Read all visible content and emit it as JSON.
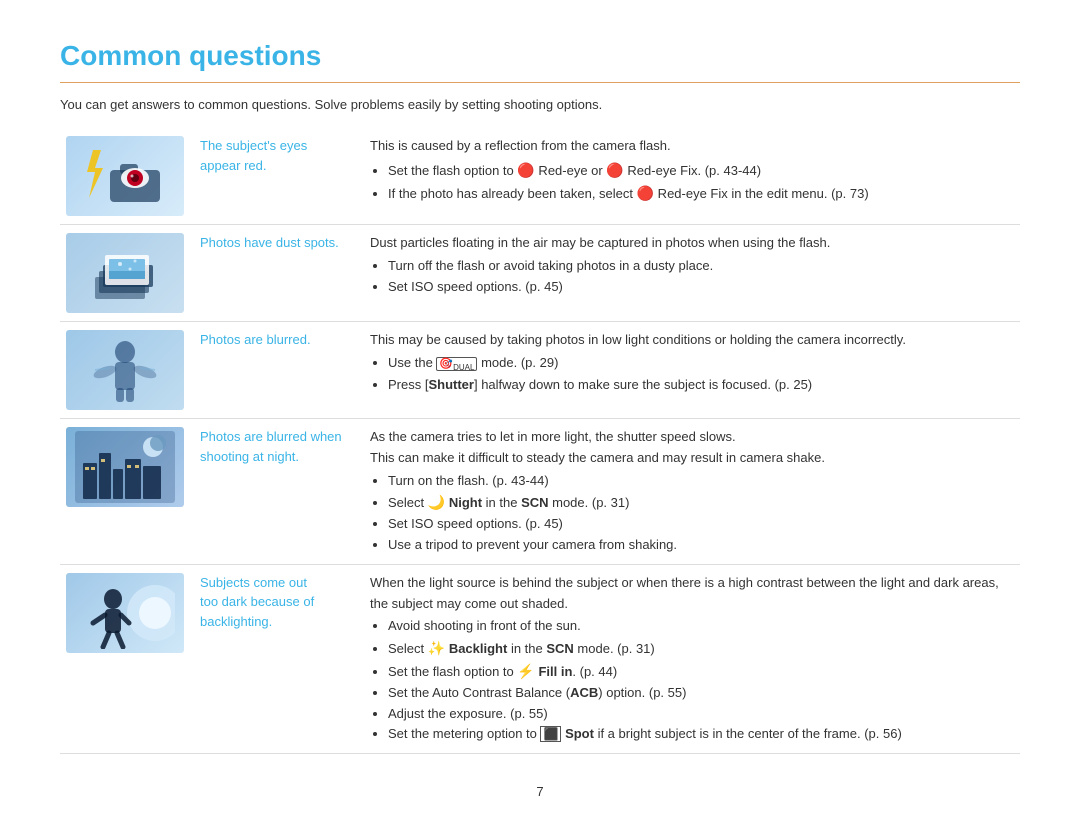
{
  "page": {
    "title": "Common questions",
    "intro": "You can get answers to common questions. Solve problems easily by setting shooting options.",
    "page_number": "7"
  },
  "rows": [
    {
      "id": "red-eye",
      "link": "The subject's eyes\nappear red.",
      "content_intro": "This is caused by a reflection from the camera flash.",
      "bullets": [
        "Set the flash option to 🔴 Red-eye or 🔴 Red-eye Fix. (p. 43-44)",
        "If the photo has already been taken, select 🔴 Red-eye Fix in the edit menu. (p. 73)"
      ]
    },
    {
      "id": "dust",
      "link": "Photos have dust spots.",
      "content_intro": "Dust particles floating in the air may be captured in photos when using the flash.",
      "bullets": [
        "Turn off the flash or avoid taking photos in a dusty place.",
        "Set ISO speed options. (p. 45)"
      ]
    },
    {
      "id": "blurred",
      "link": "Photos are blurred.",
      "content_intro": "This may be caused by taking photos in low light conditions or holding the camera incorrectly.",
      "bullets": [
        "Use the 🎯DUAL mode. (p. 29)",
        "Press [Shutter] halfway down to make sure the subject is focused. (p. 25)"
      ]
    },
    {
      "id": "night",
      "link": "Photos are blurred when\nshooting at night.",
      "content_intro": "As the camera tries to let in more light, the shutter speed slows.\nThis can make it difficult to steady the camera and may result in camera shake.",
      "bullets": [
        "Turn on the flash. (p. 43-44)",
        "Select 🌙 Night in the SCN mode. (p. 31)",
        "Set ISO speed options. (p. 45)",
        "Use a tripod to prevent your camera from shaking."
      ]
    },
    {
      "id": "backlight",
      "link": "Subjects come out\ntoo dark because of\nbacklighting.",
      "content_intro": "When the light source is behind the subject or when there is a high contrast between the light and dark areas, the subject may come out shaded.",
      "bullets": [
        "Avoid shooting in front of the sun.",
        "Select 🌟 Backlight in the SCN mode. (p. 31)",
        "Set the flash option to ⚡ Fill in. (p. 44)",
        "Set the Auto Contrast Balance (ACB) option. (p. 55)",
        "Adjust the exposure. (p. 55)",
        "Set the metering option to ⬛ Spot if a bright subject is in the center of the frame. (p. 56)"
      ]
    }
  ]
}
